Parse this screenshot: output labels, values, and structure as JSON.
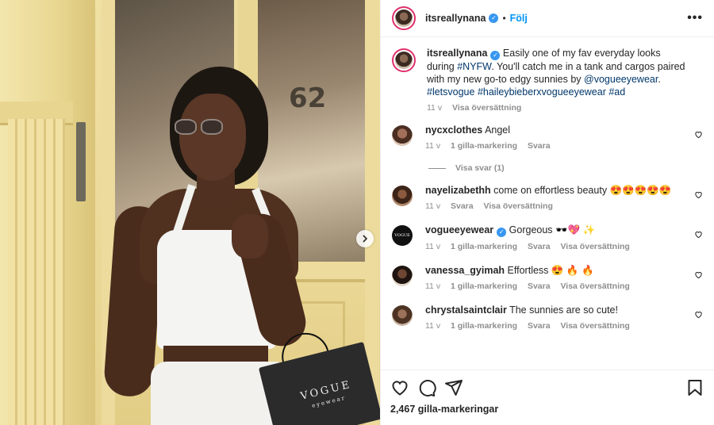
{
  "header": {
    "username": "itsreallynana",
    "follow_label": "Följ",
    "separator": "•"
  },
  "photo": {
    "door_number": "62",
    "bag_brand": "VOGUE",
    "bag_sub": "eyewear"
  },
  "caption": {
    "username": "itsreallynana",
    "text_plain": "Easily one of my fav everyday looks during",
    "tag_nyfw": "#NYFW",
    "text_middle": ". You'll catch me in a tank and cargos paired with my new go-to edgy sunnies by",
    "mention": "@vogueeyewear",
    "text_dot": ".",
    "tag_letsvogue": "#letsvogue",
    "tag_hailey": "#haileybieberxvogueeyewear",
    "tag_ad": "#ad",
    "time": "11 v",
    "translate": "Visa översättning"
  },
  "comments": [
    {
      "username": "nycxclothes",
      "text": "Angel",
      "time": "11 v",
      "likes": "1 gilla-markering",
      "reply": "Svara",
      "translate": ""
    },
    {
      "username": "nayelizabethh",
      "text": "come on effortless beauty 😍😍😍😍😍",
      "time": "11 v",
      "likes": "",
      "reply": "Svara",
      "translate": "Visa översättning"
    },
    {
      "username": "vogueeyewear",
      "text": "Gorgeous 🕶️💖 ✨",
      "time": "11 v",
      "likes": "1 gilla-markering",
      "reply": "Svara",
      "translate": "Visa översättning"
    },
    {
      "username": "vanessa_gyimah",
      "text": "Effortless 😍 🔥 🔥",
      "time": "11 v",
      "likes": "1 gilla-markering",
      "reply": "Svara",
      "translate": "Visa översättning"
    },
    {
      "username": "chrystalsaintclair",
      "text": "The sunnies are so cute!",
      "time": "11 v",
      "likes": "1 gilla-markering",
      "reply": "Svara",
      "translate": "Visa översättning"
    }
  ],
  "view_replies": "Visa svar (1)",
  "footer": {
    "likes_count": "2,467 gilla-markeringar"
  },
  "icons": {
    "verified": "verified-badge-icon",
    "more": "more-options-icon",
    "heart": "heart-icon",
    "comment": "comment-icon",
    "share": "share-icon",
    "save": "bookmark-icon",
    "next": "chevron-right-icon"
  },
  "colors": {
    "link_blue": "#0095f6",
    "hashtag": "#00376b",
    "verified": "#3897f0",
    "muted": "#8e8e8e",
    "story_ring": "#e1306c"
  }
}
